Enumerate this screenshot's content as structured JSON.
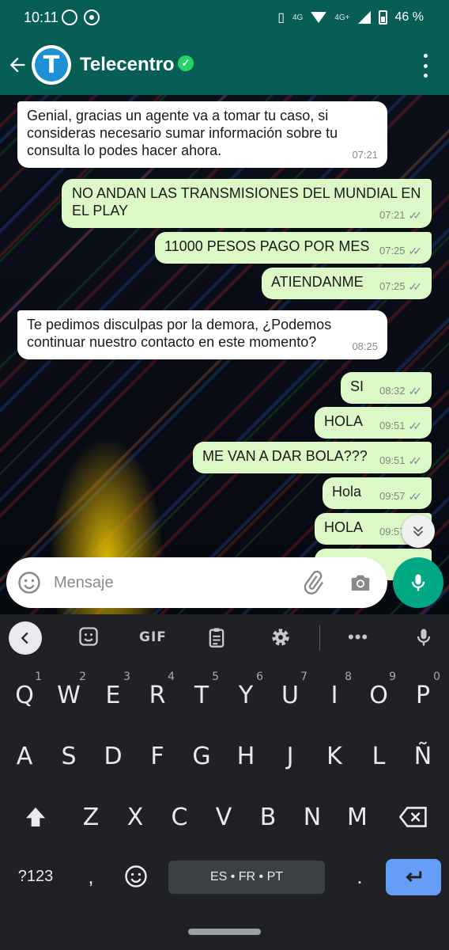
{
  "status_bar": {
    "time": "10:11",
    "network_1": "4G",
    "network_2": "4G+",
    "battery": "46 %"
  },
  "header": {
    "avatar_letter": "T",
    "contact_name": "Telecentro",
    "verified_icon": "check-badge-icon"
  },
  "messages": [
    {
      "dir": "in",
      "text": "Genial, gracias un agente va a tomar tu caso, si consideras necesario sumar información sobre tu consulta lo podes hacer ahora.",
      "time": "07:21"
    },
    {
      "dir": "out",
      "text": "NO ANDAN LAS TRANSMISIONES DEL MUNDIAL EN EL PLAY",
      "time": "07:21"
    },
    {
      "dir": "out",
      "text": "11000 PESOS PAGO POR MES",
      "time": "07:25"
    },
    {
      "dir": "out",
      "text": "ATIENDANME",
      "time": "07:25"
    },
    {
      "dir": "in",
      "text": "Te pedimos disculpas por la demora, ¿Podemos continuar nuestro contacto en este momento?",
      "time": "08:25"
    },
    {
      "dir": "out",
      "text": "SI",
      "time": "08:32"
    },
    {
      "dir": "out",
      "text": "HOLA",
      "time": "09:51"
    },
    {
      "dir": "out",
      "text": "ME VAN A DAR BOLA???",
      "time": "09:51"
    },
    {
      "dir": "out",
      "text": "Hola",
      "time": "09:57"
    },
    {
      "dir": "out",
      "text": "HOLA",
      "time": "09:57"
    }
  ],
  "input": {
    "placeholder": "Mensaje"
  },
  "keyboard": {
    "toolbar": {
      "gif": "GIF"
    },
    "row1": [
      {
        "k": "Q",
        "n": "1"
      },
      {
        "k": "W",
        "n": "2"
      },
      {
        "k": "E",
        "n": "3"
      },
      {
        "k": "R",
        "n": "4"
      },
      {
        "k": "T",
        "n": "5"
      },
      {
        "k": "Y",
        "n": "6"
      },
      {
        "k": "U",
        "n": "7"
      },
      {
        "k": "I",
        "n": "8"
      },
      {
        "k": "O",
        "n": "9"
      },
      {
        "k": "P",
        "n": "0"
      }
    ],
    "row2": [
      "A",
      "S",
      "D",
      "F",
      "G",
      "H",
      "J",
      "K",
      "L",
      "Ñ"
    ],
    "row3": [
      "Z",
      "X",
      "C",
      "V",
      "B",
      "N",
      "M"
    ],
    "symbols_key": "?123",
    "comma": ",",
    "space_label": "ES • FR • PT",
    "period": "."
  },
  "colors": {
    "header": "#075e54",
    "outgoing_bubble": "#dcf8c6",
    "incoming_bubble": "#ffffff",
    "mic_button": "#00a884",
    "keyboard_bg": "#202124",
    "enter_key": "#669df6"
  }
}
